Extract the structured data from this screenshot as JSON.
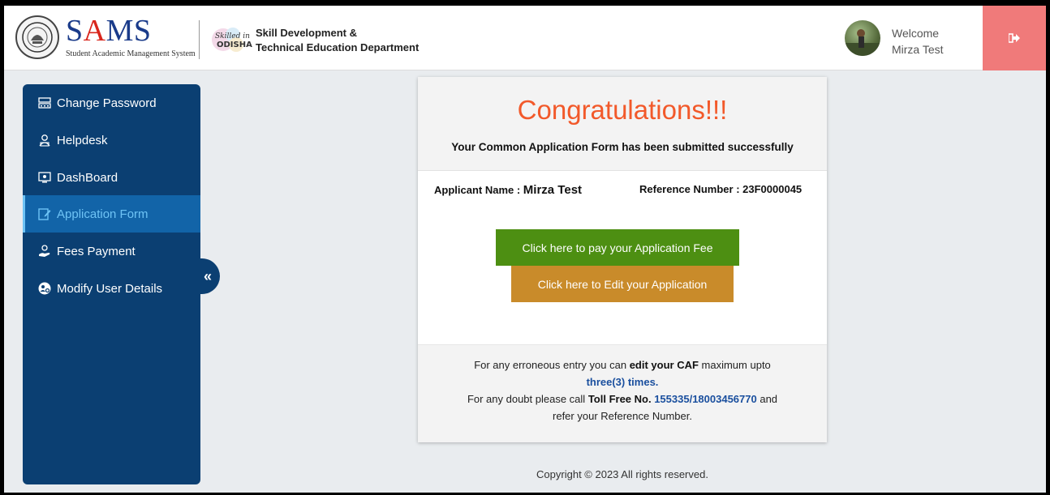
{
  "header": {
    "brand_prefix": "S",
    "brand_accent": "A",
    "brand_suffix": "MS",
    "brand_subtitle": "Student Academic Management System",
    "partner_logo_text": "Skilled in ODISHA",
    "dept_line1": "Skill Development &",
    "dept_line2": "Technical Education Department",
    "welcome_label": "Welcome",
    "user_name": "Mirza Test",
    "logout_icon": "sign-out-icon"
  },
  "sidebar": {
    "items": [
      {
        "label": "Change Password",
        "icon": "keyboard-icon",
        "active": false
      },
      {
        "label": "Helpdesk",
        "icon": "user-headset-icon",
        "active": false
      },
      {
        "label": "DashBoard",
        "icon": "monitor-icon",
        "active": false
      },
      {
        "label": "Application Form",
        "icon": "edit-form-icon",
        "active": true
      },
      {
        "label": "Fees Payment",
        "icon": "hand-coins-icon",
        "active": false
      },
      {
        "label": "Modify User Details",
        "icon": "user-cog-icon",
        "active": false
      }
    ],
    "collapse_glyph": "«"
  },
  "card": {
    "heading": "Congratulations!!!",
    "message": "Your Common Application Form has been submitted successfully",
    "applicant_label": "Applicant Name : ",
    "applicant_value": "Mirza Test",
    "reference_label": "Reference Number : ",
    "reference_value": "23F0000045",
    "pay_button": "Click here to pay your Application Fee",
    "edit_button": "Click here to Edit your Application",
    "note_line1_a": "For any erroneous entry you can ",
    "note_line1_b": "edit your CAF",
    "note_line1_c": " maximum upto",
    "note_line2": "three(3) times.",
    "note_line3_a": "For any doubt please call ",
    "note_line3_b": "Toll Free No.",
    "note_line3_c": "155335/18003456770",
    "note_line3_d": " and",
    "note_line4": "refer your Reference Number."
  },
  "footer": {
    "copyright": "Copyright © 2023 All rights reserved."
  },
  "colors": {
    "sidebar_bg": "#0b3f72",
    "active_item_bg": "#1264a8",
    "congrats": "#f2592a",
    "pay_button": "#4d8f12",
    "edit_button": "#c98b2a",
    "logout_bg": "#f07a7a"
  }
}
